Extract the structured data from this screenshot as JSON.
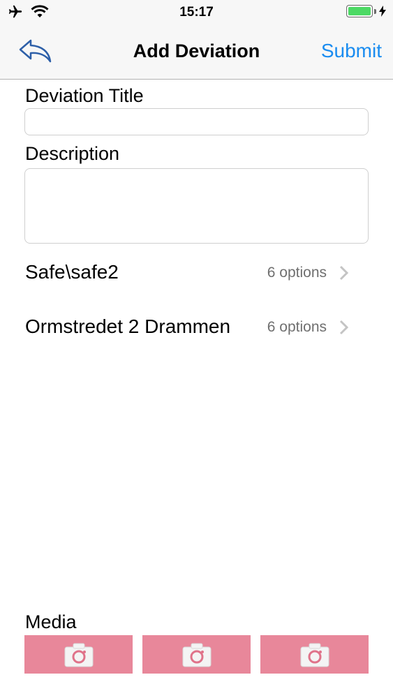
{
  "status_bar": {
    "time": "15:17",
    "icons": [
      "airplane-icon",
      "wifi-icon",
      "battery-icon",
      "charging-bolt-icon"
    ],
    "battery_level": 1.0,
    "battery_color": "#4cd964"
  },
  "nav": {
    "back_icon": "reply-arrow-icon",
    "title": "Add Deviation",
    "submit_label": "Submit",
    "accent_color": "#1a8cf0"
  },
  "form": {
    "title_label": "Deviation Title",
    "title_value": "",
    "title_placeholder": "",
    "description_label": "Description",
    "description_value": "",
    "description_placeholder": ""
  },
  "options": [
    {
      "label": "Safe\\safe2",
      "count": "6 options"
    },
    {
      "label": "Ormstredet 2 Drammen",
      "count": "6 options"
    }
  ],
  "media": {
    "label": "Media",
    "tile_icon": "camera-icon",
    "tile_color": "#e8879a",
    "tile_count": 3
  }
}
